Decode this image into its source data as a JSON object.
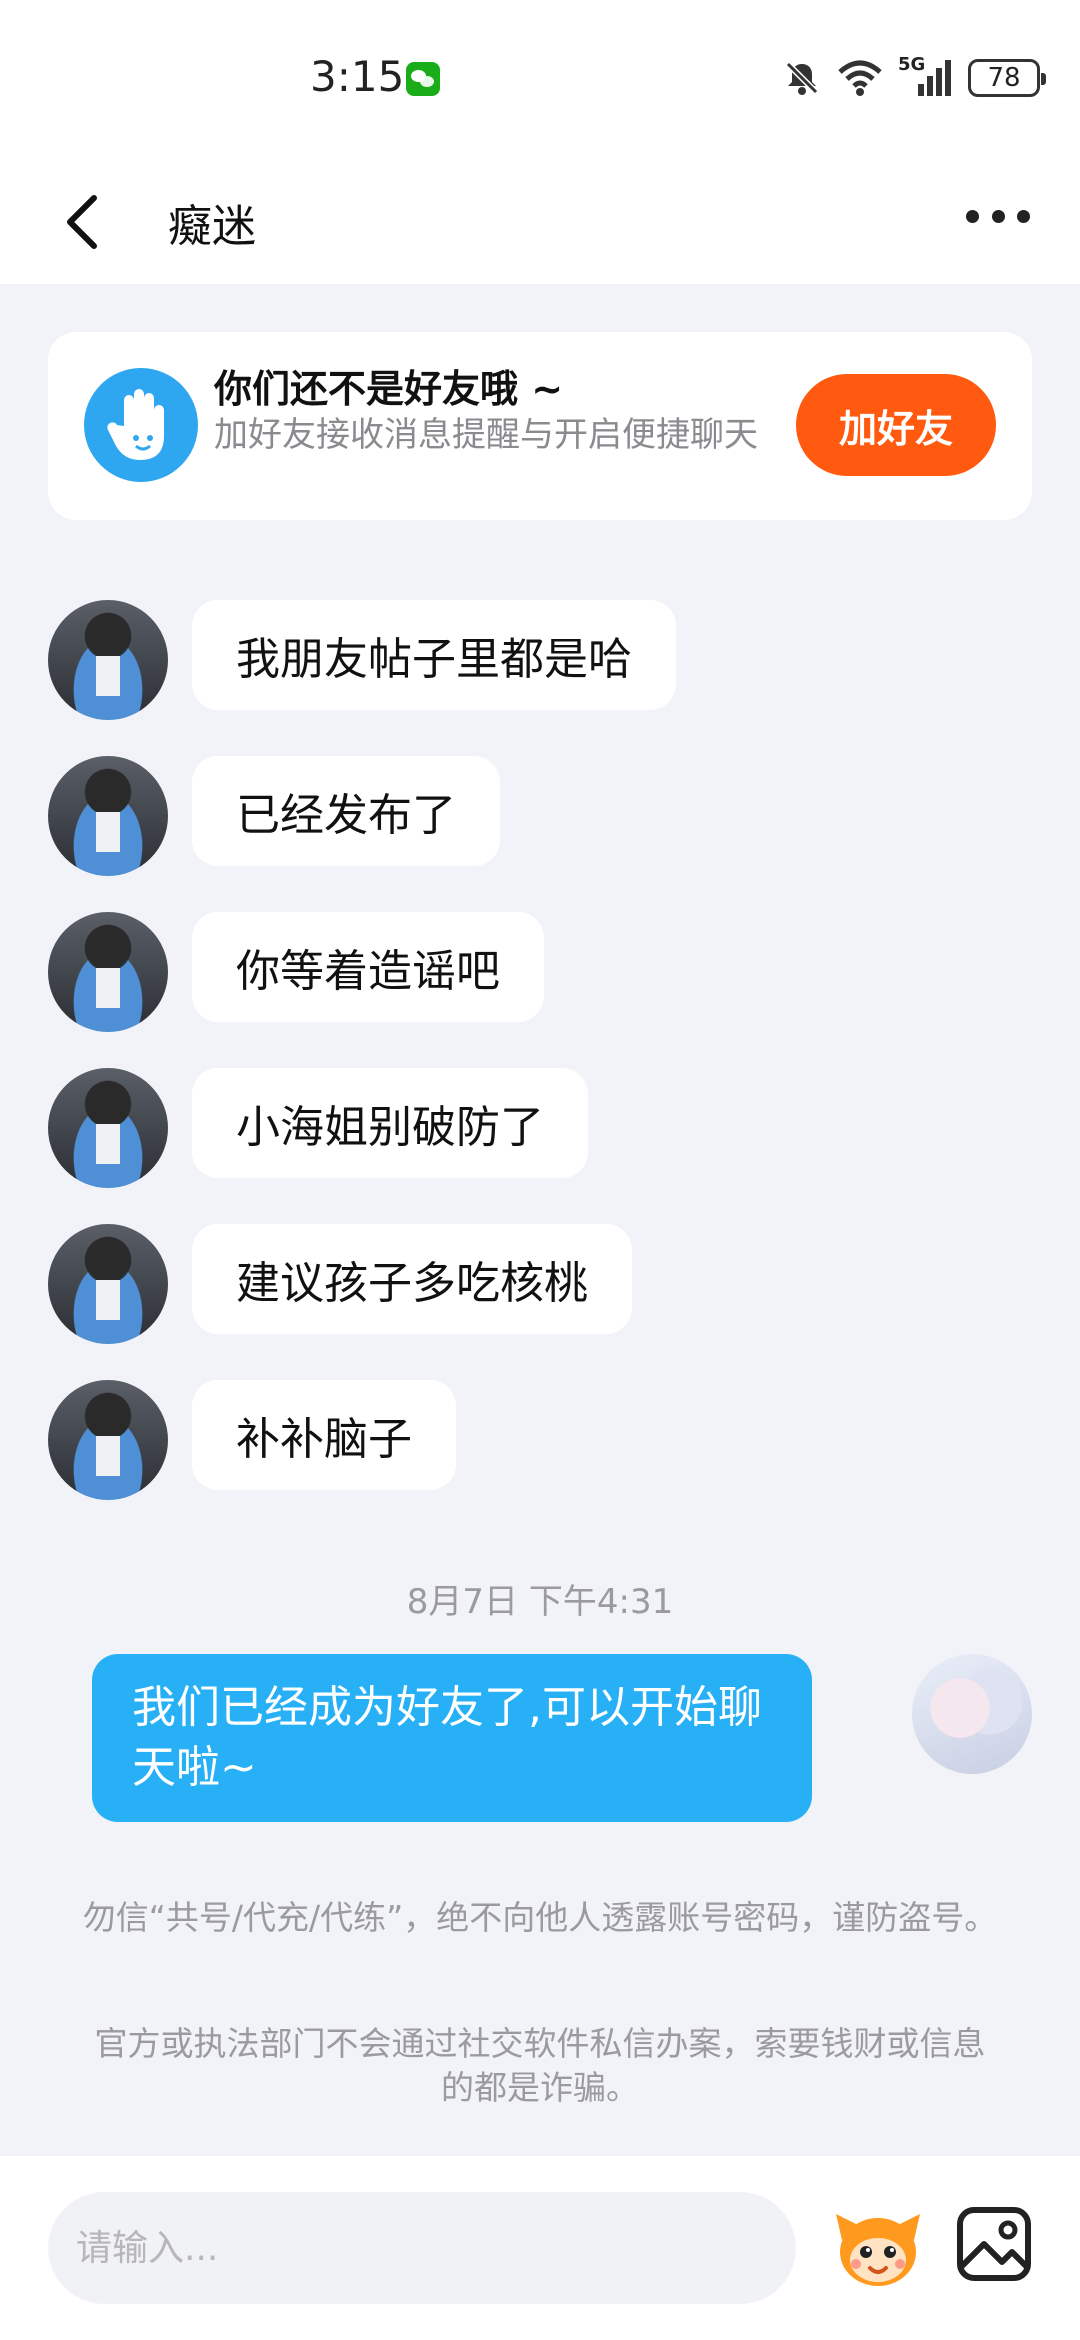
{
  "status_bar": {
    "time": "3:15",
    "network": "5G",
    "battery": "78",
    "icons": [
      "wechat-notification-icon",
      "mute-icon",
      "wifi-icon",
      "signal-icon",
      "battery-icon"
    ]
  },
  "header": {
    "title": "癡迷",
    "back_icon": "chevron-left-icon",
    "more_icon": "more-dots-icon"
  },
  "friend_card": {
    "title": "你们还不是好友哦 ~",
    "description": "加好友接收消息提醒与开启便捷聊天",
    "button": "加好友",
    "icon": "hand-wave-icon",
    "colors": {
      "icon_bg": "#2fa7f0",
      "button_bg": "#ff5a0f"
    }
  },
  "messages": [
    {
      "sender": "other",
      "text": "我朋友帖子里都是哈"
    },
    {
      "sender": "other",
      "text": "已经发布了"
    },
    {
      "sender": "other",
      "text": "你等着造谣吧"
    },
    {
      "sender": "other",
      "text": "小海姐别破防了"
    },
    {
      "sender": "other",
      "text": "建议孩子多吃核桃"
    },
    {
      "sender": "other",
      "text": "补补脑子"
    }
  ],
  "timestamp": "8月7日 下午4:31",
  "my_message": {
    "sender": "me",
    "text": "我们已经成为好友了,可以开始聊天啦~",
    "color": "#27b0f6"
  },
  "notices": [
    "勿信“共号/代充/代练”，绝不向他人透露账号密码，谨防盗号。",
    "官方或执法部门不会通过社交软件私信办案，索要钱财或信息的都是诈骗。"
  ],
  "input_bar": {
    "placeholder": "请输入...",
    "emoji_icon": "mascot-emoji-icon",
    "image_icon": "image-picker-icon"
  }
}
